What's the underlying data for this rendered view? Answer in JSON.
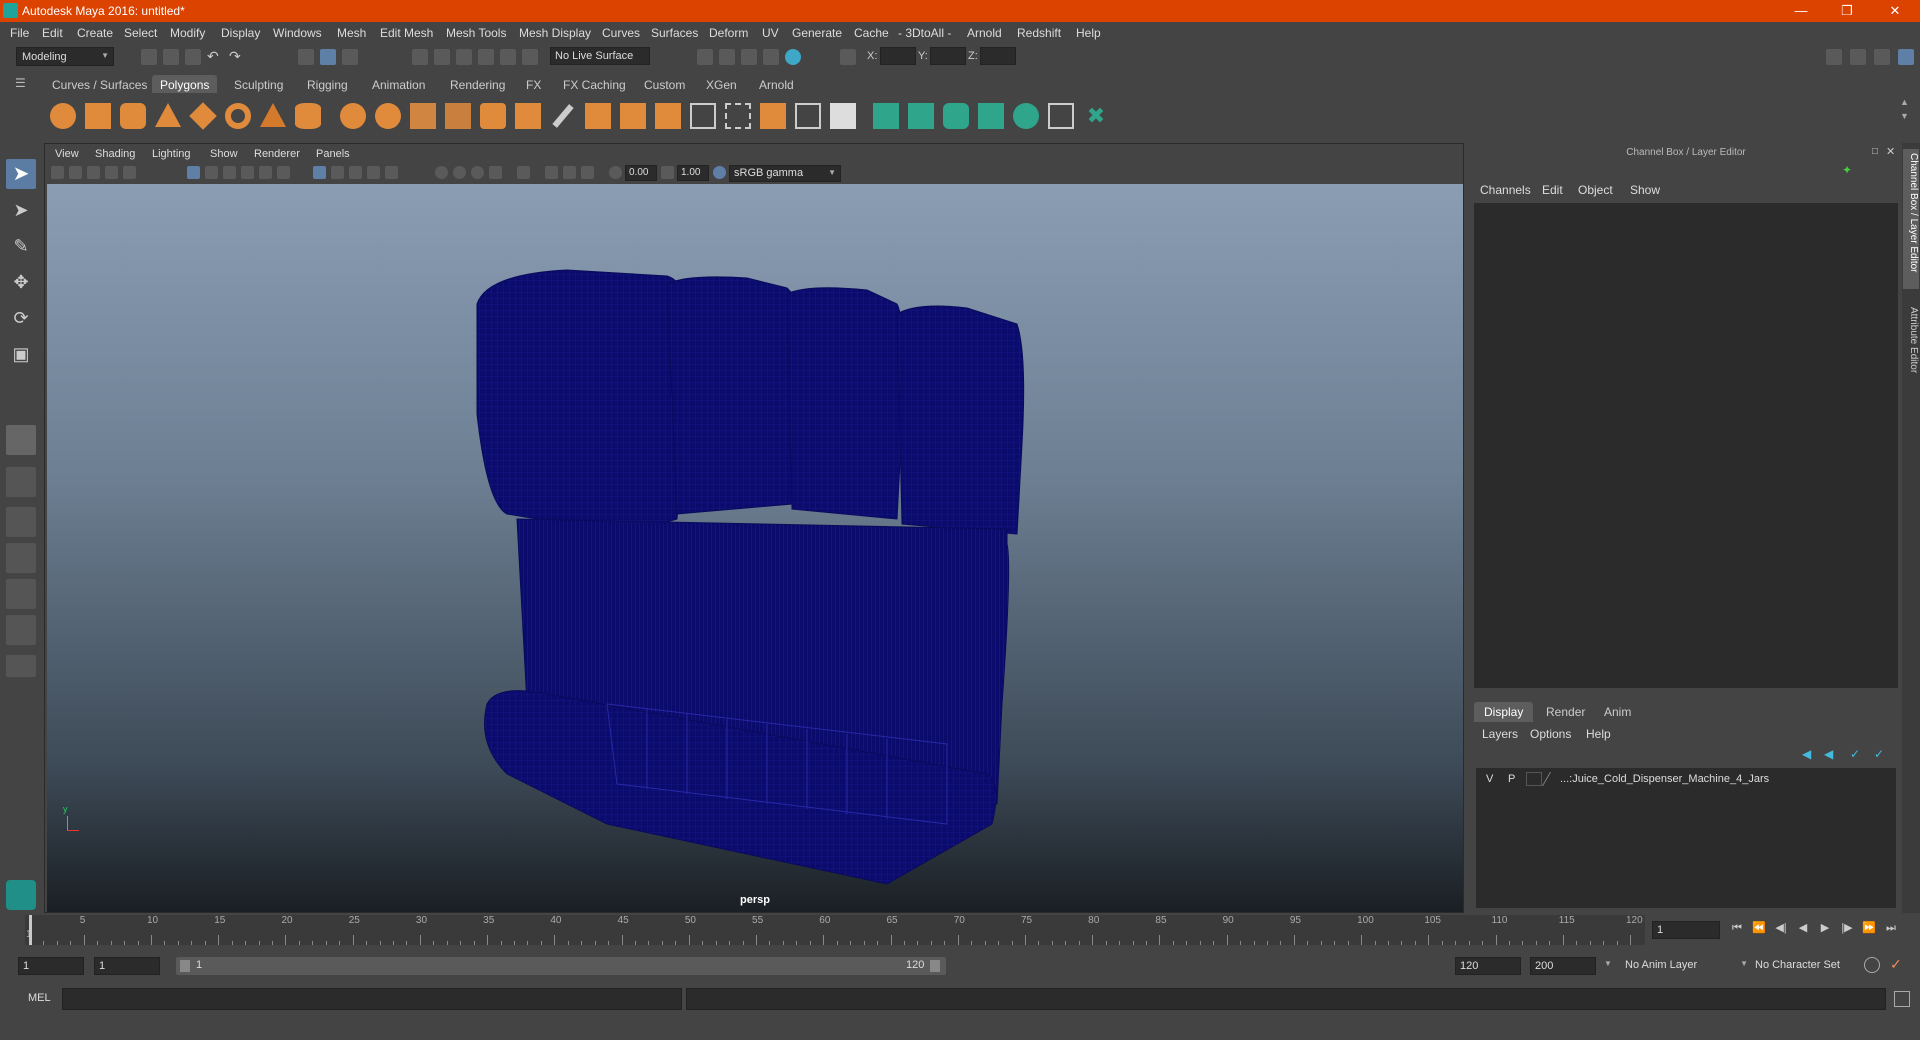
{
  "window": {
    "title": "Autodesk Maya 2016: untitled*"
  },
  "menubar": [
    "File",
    "Edit",
    "Create",
    "Select",
    "Modify",
    "Display",
    "Windows",
    "Mesh",
    "Edit Mesh",
    "Mesh Tools",
    "Mesh Display",
    "Curves",
    "Surfaces",
    "Deform",
    "UV",
    "Generate",
    "Cache",
    "- 3DtoAll -",
    "Arnold",
    "Redshift",
    "Help"
  ],
  "status": {
    "mode": "Modeling",
    "live_surface": "No Live Surface",
    "x_label": "X:",
    "y_label": "Y:",
    "z_label": "Z:"
  },
  "shelf_tabs": [
    "Curves / Surfaces",
    "Polygons",
    "Sculpting",
    "Rigging",
    "Animation",
    "Rendering",
    "FX",
    "FX Caching",
    "Custom",
    "XGen",
    "Arnold"
  ],
  "shelf_active": "Polygons",
  "viewport": {
    "menus": [
      "View",
      "Shading",
      "Lighting",
      "Show",
      "Renderer",
      "Panels"
    ],
    "exposure": "0.00",
    "gamma": "1.00",
    "color_space": "sRGB gamma",
    "camera_label": "persp"
  },
  "right_panel": {
    "title": "Channel Box / Layer Editor",
    "menus": [
      "Channels",
      "Edit",
      "Object",
      "Show"
    ],
    "tabs": [
      "Display",
      "Render",
      "Anim"
    ],
    "active_tab": "Display",
    "layer_menus": [
      "Layers",
      "Options",
      "Help"
    ],
    "layer": {
      "v": "V",
      "p": "P",
      "name": "...:Juice_Cold_Dispenser_Machine_4_Jars"
    }
  },
  "side_tabs": [
    "Channel Box / Layer Editor",
    "Attribute Editor"
  ],
  "timeline": {
    "ticks": [
      1,
      5,
      10,
      15,
      20,
      25,
      30,
      35,
      40,
      45,
      50,
      55,
      60,
      65,
      70,
      75,
      80,
      85,
      90,
      95,
      100,
      105,
      110,
      115,
      120
    ],
    "current_frame": "1"
  },
  "range": {
    "start": "1",
    "playback_start": "1",
    "slider_start": "1",
    "slider_end": "120",
    "playback_end": "120",
    "end": "200",
    "anim_layer": "No Anim Layer",
    "character_set": "No Character Set"
  },
  "cmdline": {
    "label": "MEL"
  },
  "colors": {
    "titlebar": "#dc4200",
    "mesh_wire": "#0b0b6e",
    "accent": "#5c7da3"
  }
}
